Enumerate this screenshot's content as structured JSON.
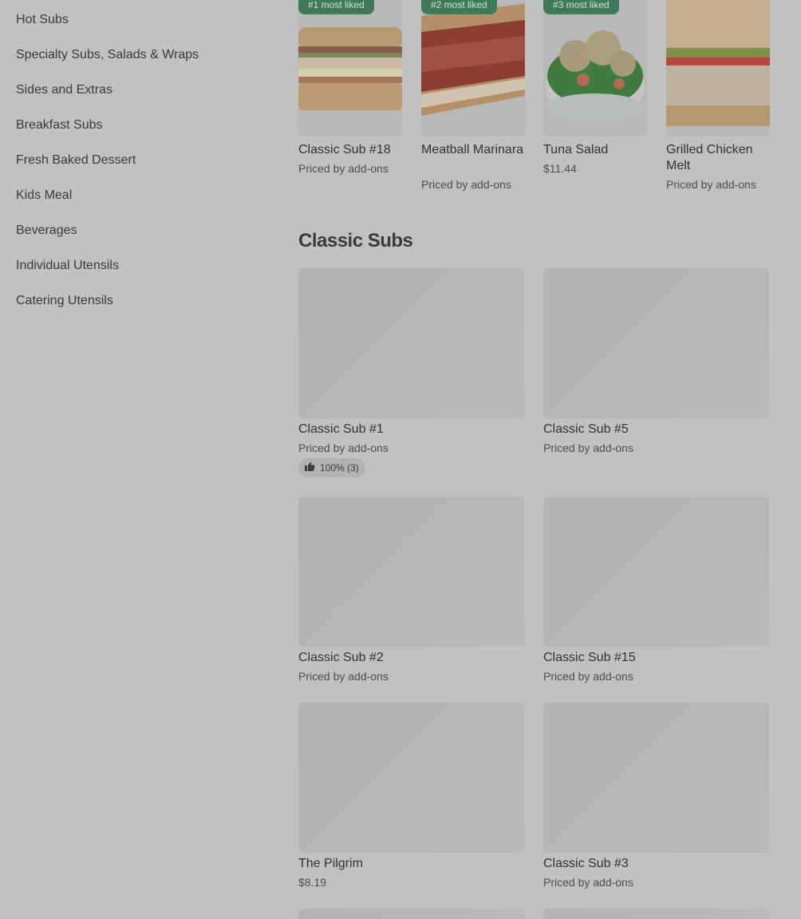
{
  "sidebar": {
    "items": [
      {
        "label": "Hot Subs"
      },
      {
        "label": "Specialty Subs, Salads & Wraps"
      },
      {
        "label": "Sides and Extras"
      },
      {
        "label": "Breakfast Subs"
      },
      {
        "label": "Fresh Baked Dessert"
      },
      {
        "label": "Kids Meal"
      },
      {
        "label": "Beverages"
      },
      {
        "label": "Individual Utensils"
      },
      {
        "label": "Catering Utensils"
      }
    ]
  },
  "featured": [
    {
      "badge": "#1 most liked",
      "title": "Classic Sub #18",
      "price": "Priced by add-ons"
    },
    {
      "badge": "#2 most liked",
      "title": "Meatball Marinara",
      "price": "Priced by add-ons"
    },
    {
      "badge": "#3 most liked",
      "title": "Tuna Salad",
      "price": "$11.44"
    },
    {
      "badge": "",
      "title": "Grilled Chicken Melt",
      "price": "Priced by add-ons"
    }
  ],
  "section": {
    "title": "Classic Subs"
  },
  "items": [
    {
      "title": "Classic Sub #1",
      "price": "Priced by add-ons",
      "rating": "100% (3)"
    },
    {
      "title": "Classic Sub #5",
      "price": "Priced by add-ons"
    },
    {
      "title": "Classic Sub #2",
      "price": "Priced by add-ons"
    },
    {
      "title": "Classic Sub #15",
      "price": "Priced by add-ons"
    },
    {
      "title": "The Pilgrim",
      "price": "$8.19"
    },
    {
      "title": "Classic Sub #3",
      "price": "Priced by add-ons"
    }
  ],
  "colors": {
    "background": "#c1c1c1",
    "badge": "#3f7a58",
    "placeholder": "#b5b5b5"
  },
  "icons": {
    "rating": "thumbs-up-icon"
  }
}
